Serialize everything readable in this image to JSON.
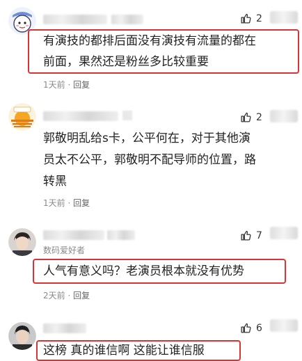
{
  "comments": [
    {
      "likes": "2",
      "text_lines": [
        "有演技的都排后面没有演技有流量的都在",
        "前面，果然还是粉丝多比较重要"
      ],
      "time": "1天前",
      "dot": " · ",
      "reply": "回复"
    },
    {
      "likes": "2",
      "text_lines": [
        "郭敬明乱给s卡，公平何在，对于其他演",
        "员太不公平，郭敬明不配导师的位置，路",
        "转黑"
      ],
      "time": "1天前",
      "dot": " · ",
      "reply": "回复"
    },
    {
      "likes": "7",
      "badge": "数码爱好者",
      "text_lines": [
        "人气有意义吗？老演员根本就没有优势"
      ],
      "time": "2天前",
      "dot": " · ",
      "reply": "回复"
    },
    {
      "likes": "6",
      "text_lines": [
        "这榜 真的谁信啊 这能让谁信服"
      ]
    }
  ],
  "colors": {
    "highlight_border": "#d93434",
    "meta_text": "#8a8a8a"
  },
  "icons": {
    "like": "thumbs-up-icon"
  }
}
